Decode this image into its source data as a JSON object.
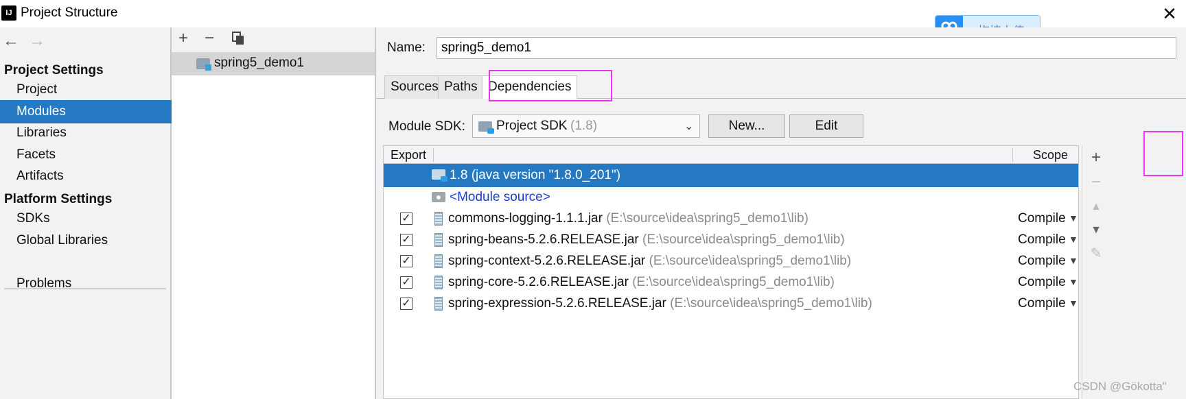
{
  "window": {
    "title": "Project Structure",
    "close_icon": "close-icon"
  },
  "upload_widget": {
    "label": "拖拽上传",
    "accent": "#2a8ff5"
  },
  "nav": {
    "sections": [
      {
        "title": "Project Settings",
        "items": [
          "Project",
          "Modules",
          "Libraries",
          "Facets",
          "Artifacts"
        ]
      },
      {
        "title": "Platform Settings",
        "items": [
          "SDKs",
          "Global Libraries"
        ]
      }
    ],
    "problems": "Problems",
    "selected": "Modules",
    "selected_color": "#2479c2"
  },
  "tree": {
    "module": "spring5_demo1"
  },
  "detail": {
    "name_label": "Name:",
    "name_value": "spring5_demo1",
    "tabs": [
      "Sources",
      "Paths",
      "Dependencies"
    ],
    "active_tab": "Dependencies",
    "module_sdk_label": "Module SDK:",
    "module_sdk_value": "Project SDK",
    "module_sdk_version": "(1.8)",
    "new_button": "New...",
    "edit_button": "Edit"
  },
  "deps": {
    "col_export": "Export",
    "col_scope": "Scope",
    "sdk_row": "1.8 (java version \"1.8.0_201\")",
    "module_source_row": "<Module source>",
    "rows": [
      {
        "name": "commons-logging-1.1.1.jar",
        "path": "(E:\\source\\idea\\spring5_demo1\\lib)",
        "scope": "Compile",
        "checked": true
      },
      {
        "name": "spring-beans-5.2.6.RELEASE.jar",
        "path": "(E:\\source\\idea\\spring5_demo1\\lib)",
        "scope": "Compile",
        "checked": true
      },
      {
        "name": "spring-context-5.2.6.RELEASE.jar",
        "path": "(E:\\source\\idea\\spring5_demo1\\lib)",
        "scope": "Compile",
        "checked": true
      },
      {
        "name": "spring-core-5.2.6.RELEASE.jar",
        "path": "(E:\\source\\idea\\spring5_demo1\\lib)",
        "scope": "Compile",
        "checked": true
      },
      {
        "name": "spring-expression-5.2.6.RELEASE.jar",
        "path": "(E:\\source\\idea\\spring5_demo1\\lib)",
        "scope": "Compile",
        "checked": true
      }
    ]
  },
  "highlight_color": "#e837e8",
  "watermark": "CSDN @Gökotta\""
}
